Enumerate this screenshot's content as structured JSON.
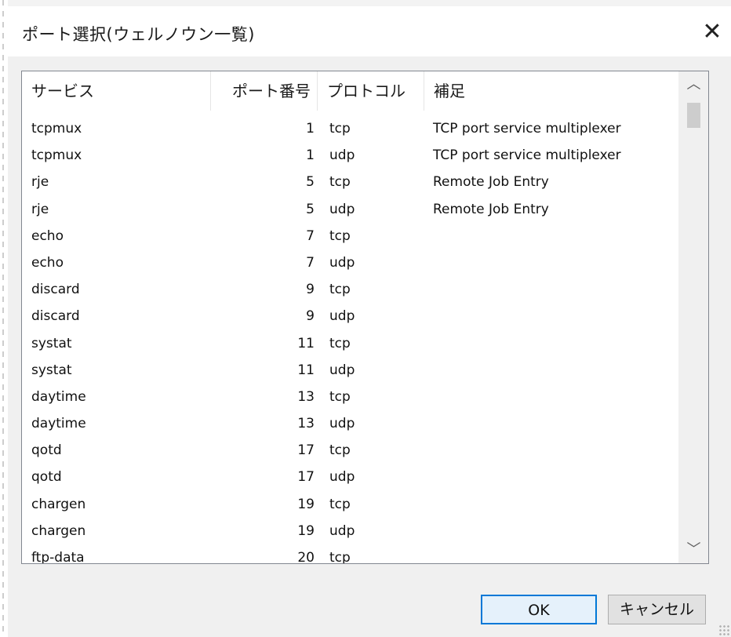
{
  "dialog": {
    "title": "ポート選択(ウェルノウン一覧)",
    "close_glyph": "✕"
  },
  "table": {
    "columns": [
      "サービス",
      "ポート番号",
      "プロトコル",
      "補足"
    ],
    "rows": [
      [
        "tcpmux",
        "1",
        "tcp",
        "TCP port service multiplexer"
      ],
      [
        "tcpmux",
        "1",
        "udp",
        "TCP port service multiplexer"
      ],
      [
        "rje",
        "5",
        "tcp",
        "Remote Job Entry"
      ],
      [
        "rje",
        "5",
        "udp",
        "Remote Job Entry"
      ],
      [
        "echo",
        "7",
        "tcp",
        ""
      ],
      [
        "echo",
        "7",
        "udp",
        ""
      ],
      [
        "discard",
        "9",
        "tcp",
        ""
      ],
      [
        "discard",
        "9",
        "udp",
        ""
      ],
      [
        "systat",
        "11",
        "tcp",
        ""
      ],
      [
        "systat",
        "11",
        "udp",
        ""
      ],
      [
        "daytime",
        "13",
        "tcp",
        ""
      ],
      [
        "daytime",
        "13",
        "udp",
        ""
      ],
      [
        "qotd",
        "17",
        "tcp",
        ""
      ],
      [
        "qotd",
        "17",
        "udp",
        ""
      ],
      [
        "chargen",
        "19",
        "tcp",
        ""
      ],
      [
        "chargen",
        "19",
        "udp",
        ""
      ],
      [
        "ftp-data",
        "20",
        "tcp",
        ""
      ]
    ]
  },
  "scrollbar": {
    "up_glyph": "︿",
    "down_glyph": "﹀"
  },
  "buttons": {
    "ok_label": "OK",
    "cancel_label": "キャンセル"
  },
  "colors": {
    "accent": "#0078d7"
  }
}
